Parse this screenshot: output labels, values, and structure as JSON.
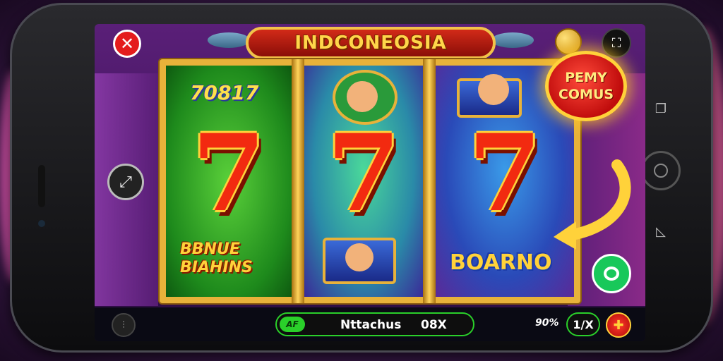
{
  "header": {
    "title": "INDCONEOSIA",
    "close_icon": "close-icon",
    "screen_icon": "crop-screen-icon"
  },
  "bonus_badge": {
    "line1": "PEMY",
    "line2": "COMUS"
  },
  "reels": [
    {
      "symbol": "7",
      "top_label": "70817",
      "bottom_label_1": "BBNUE",
      "bottom_label_2": "BIAHINS"
    },
    {
      "symbol": "7"
    },
    {
      "symbol": "7",
      "bottom_label": "BOARNO"
    }
  ],
  "side_controls": {
    "share_icon": "share-icon",
    "chat_icon": "chat-icon"
  },
  "bottom_bar": {
    "menu_icon": "menu-icon",
    "status_tag": "AF",
    "status_label": "Nttachus",
    "status_value": "08X",
    "percent": "90%",
    "speed_label": "1/X",
    "spin_icon": "spin-icon"
  },
  "colors": {
    "frame_gold": "#e8b23a",
    "seven_red": "#f22a10",
    "status_green": "#2ad02a",
    "badge_red": "#c00c0c"
  }
}
